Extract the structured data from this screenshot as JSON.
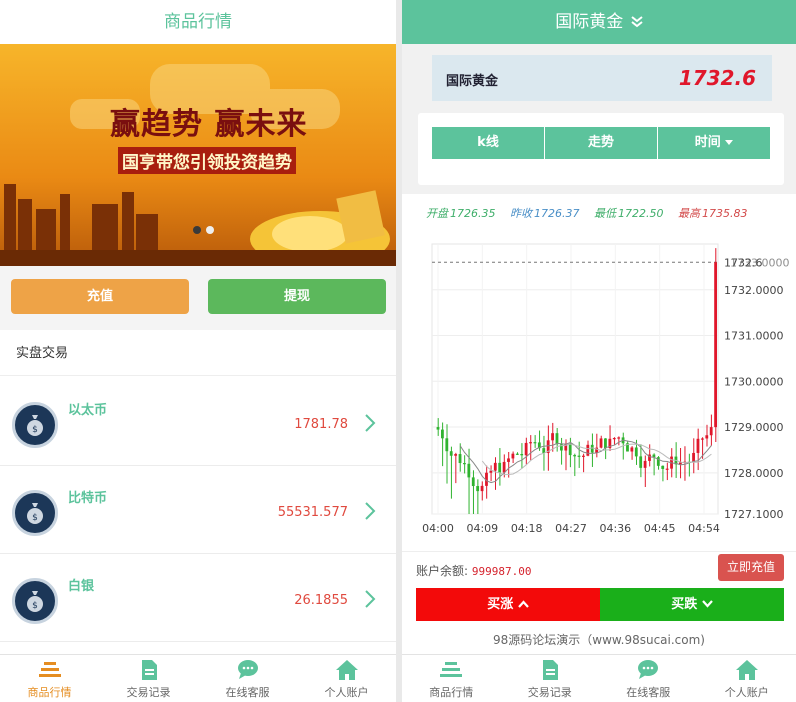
{
  "left": {
    "title": "商品行情",
    "banner": {
      "headline": "赢趋势 赢未来",
      "subline": "国亨带您引领投资趋势"
    },
    "recharge_label": "充值",
    "withdraw_label": "提现",
    "section_title": "实盘交易",
    "items": [
      {
        "name": "以太币",
        "price": "1781.78"
      },
      {
        "name": "比特币",
        "price": "55531.577"
      },
      {
        "name": "白银",
        "price": "26.1855"
      }
    ],
    "tabs": [
      "商品行情",
      "交易记录",
      "在线客服",
      "个人账户"
    ]
  },
  "right": {
    "title": "国际黄金",
    "quote": {
      "name": "国际黄金",
      "price": "1732.6"
    },
    "segments": [
      "k线",
      "走势",
      "时间"
    ],
    "stats": [
      {
        "label": "开盘",
        "value": "1726.35",
        "color": "#3fae6a"
      },
      {
        "label": "昨收",
        "value": "1726.37",
        "color": "#4a8fc7"
      },
      {
        "label": "最低",
        "value": "1722.50",
        "color": "#3fae6a"
      },
      {
        "label": "最高",
        "value": "1735.83",
        "color": "#d34b4b"
      }
    ],
    "account": {
      "label": "账户余额:",
      "value": "999987.00",
      "recharge": "立即充值"
    },
    "buy_up": "买涨",
    "buy_down": "买跌",
    "footer_note": "98源码论坛演示（www.98sucai.com)",
    "tabs": [
      "商品行情",
      "交易记录",
      "在线客服",
      "个人账户"
    ]
  },
  "colors": {
    "accent": "#5cc39c",
    "up": "#e0172b",
    "down": "#2fb32f",
    "orange": "#eea347",
    "green_btn": "#5cb85c"
  },
  "chart_data": {
    "type": "candlestick",
    "x_ticks": [
      "04:00",
      "04:09",
      "04:18",
      "04:27",
      "04:36",
      "04:45",
      "04:54"
    ],
    "y_ticks": [
      "1732.0000",
      "1731.0000",
      "1730.0000",
      "1729.0000",
      "1728.0000",
      "1727.1000"
    ],
    "current_price_labels": [
      "1732.6",
      "1733.0000"
    ],
    "ylim": [
      1727.1,
      1733.0
    ]
  }
}
